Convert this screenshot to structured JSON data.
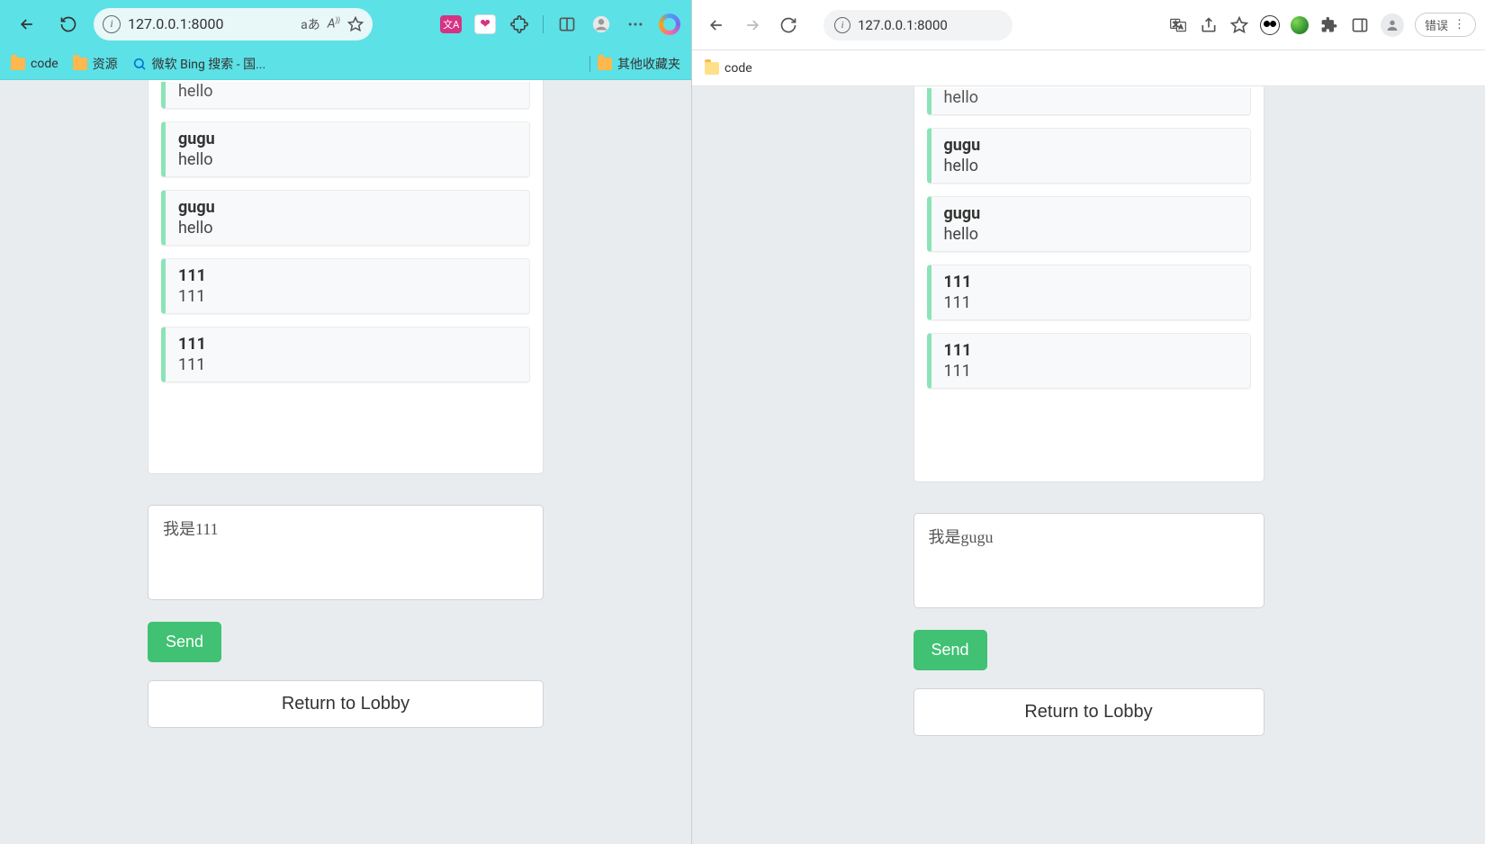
{
  "left_window": {
    "toolbar": {
      "url": "127.0.0.1:8000",
      "reading_indicator": "aあ",
      "font_btn": "A))"
    },
    "bookmarks": {
      "code": "code",
      "resources": "资源",
      "bing": "微软 Bing 搜索 - 国...",
      "other": "其他收藏夹"
    },
    "chat": {
      "messages": [
        {
          "user": "",
          "text": "hello",
          "partial_top": true
        },
        {
          "user": "gugu",
          "text": "hello"
        },
        {
          "user": "gugu",
          "text": "hello"
        },
        {
          "user": "111",
          "text": "111"
        },
        {
          "user": "111",
          "text": "111"
        }
      ],
      "input_value": "我是111",
      "send_label": "Send",
      "lobby_label": "Return to Lobby"
    }
  },
  "right_window": {
    "toolbar": {
      "url": "127.0.0.1:8000",
      "error_label": "错误"
    },
    "bookmarks": {
      "code": "code"
    },
    "chat": {
      "messages": [
        {
          "user": "",
          "text": "hello",
          "partial_top": true
        },
        {
          "user": "gugu",
          "text": "hello"
        },
        {
          "user": "gugu",
          "text": "hello"
        },
        {
          "user": "111",
          "text": "111"
        },
        {
          "user": "111",
          "text": "111"
        }
      ],
      "input_value": "我是gugu",
      "send_label": "Send",
      "lobby_label": "Return to Lobby"
    }
  }
}
